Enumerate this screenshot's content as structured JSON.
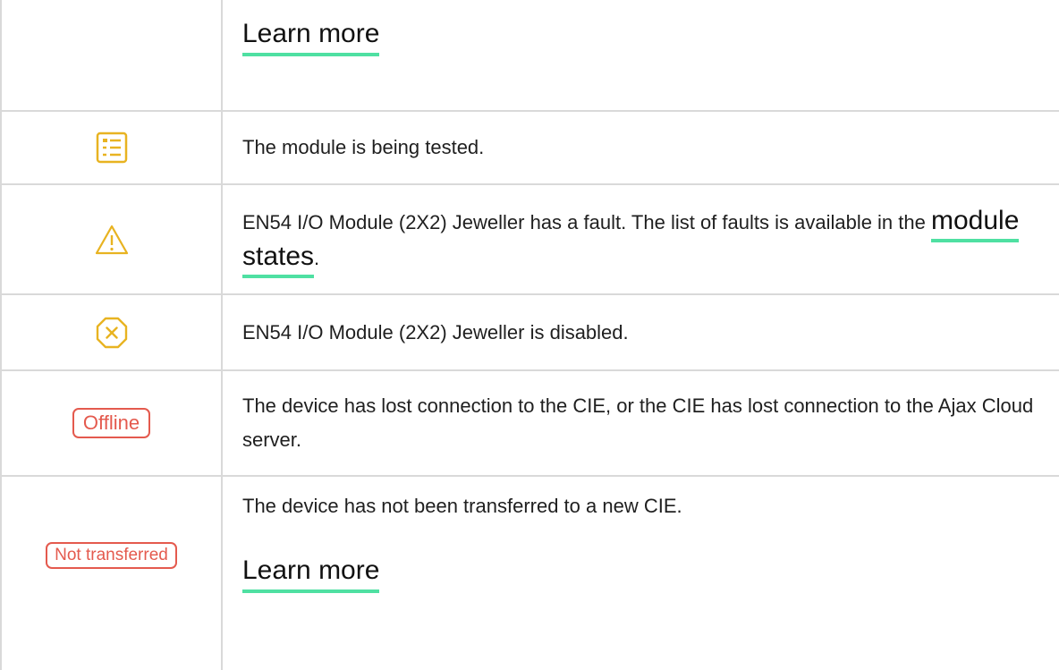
{
  "rows": [
    {
      "link": "Learn more"
    },
    {
      "icon": "checklist-icon",
      "text": "The module is being tested."
    },
    {
      "icon": "warning-triangle-icon",
      "text_before": "EN54 I/O Module (2X2) Jeweller has a fault. The list of faults is available in the ",
      "link": "module states",
      "text_after": "."
    },
    {
      "icon": "disabled-octagon-icon",
      "text": "EN54 I/O Module (2X2) Jeweller is disabled."
    },
    {
      "badge": "Offline",
      "text": "The device has lost connection to the CIE, or the CIE has lost connection to the Ajax Cloud server."
    },
    {
      "badge": "Not transferred",
      "text": "The device has not been transferred to a new CIE.",
      "link": "Learn more"
    }
  ],
  "colors": {
    "icon": "#e8b321",
    "status_red": "#e45a4e",
    "link_underline": "#4fe0a2",
    "border": "#d9d9d9"
  }
}
